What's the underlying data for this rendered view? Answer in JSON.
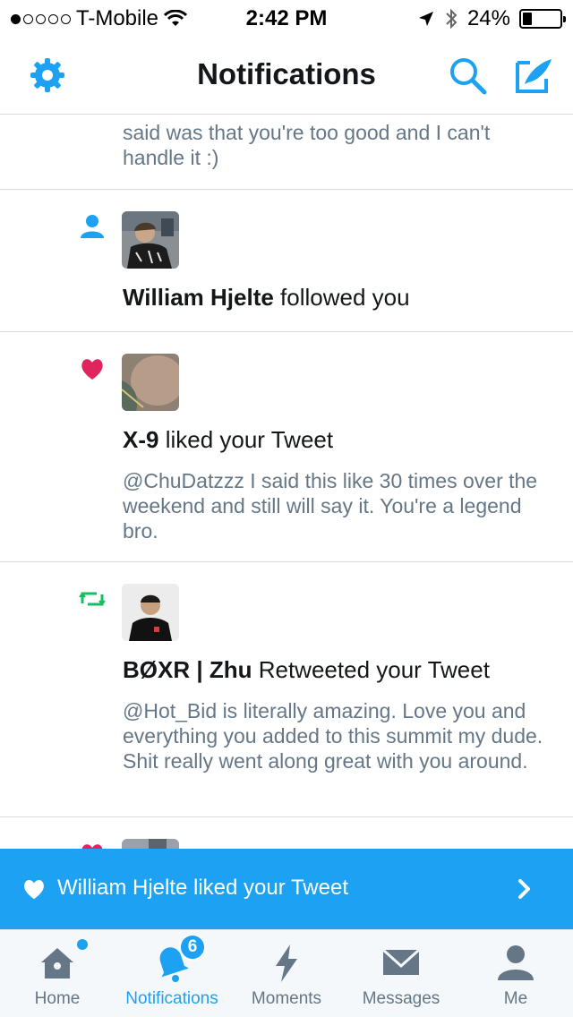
{
  "status_bar": {
    "carrier": "T-Mobile",
    "time": "2:42 PM",
    "battery": "24%",
    "battery_level": 0.24
  },
  "nav": {
    "title": "Notifications",
    "left_icon": "gear-icon",
    "right_icons": [
      "search-icon",
      "compose-tweet-icon"
    ]
  },
  "feed": {
    "previous_text": "said was that you're too good and I can't handle it :)",
    "items": [
      {
        "type": "follow",
        "icon": "person-icon",
        "user": "William Hjelte",
        "action": " followed you"
      },
      {
        "type": "like",
        "icon": "heart-icon",
        "user": "X-9",
        "action": " liked your Tweet",
        "tweet": "@ChuDatzzz I said this like 30 times over the weekend and still will say it. You're a legend bro."
      },
      {
        "type": "retweet",
        "icon": "retweet-icon",
        "user": "BØXR | Zhu",
        "action": " Retweeted your Tweet",
        "tweet": "@Hot_Bid is literally amazing. Love you and everything you added to this summit my dude. Shit really went along great with you around."
      }
    ]
  },
  "banner": {
    "text": "William Hjelte liked your Tweet"
  },
  "tab_bar": {
    "tabs": [
      {
        "label": "Home",
        "icon": "home-icon"
      },
      {
        "label": "Notifications",
        "icon": "bell-icon",
        "badge": "6",
        "active": true
      },
      {
        "label": "Moments",
        "icon": "lightning-icon"
      },
      {
        "label": "Messages",
        "icon": "envelope-icon"
      },
      {
        "label": "Me",
        "icon": "profile-icon"
      }
    ]
  },
  "colors": {
    "accent": "#1da1f2",
    "like": "#e0245e",
    "retweet": "#17bf63",
    "secondary_text": "#657786",
    "tab_inactive": "#657786"
  }
}
